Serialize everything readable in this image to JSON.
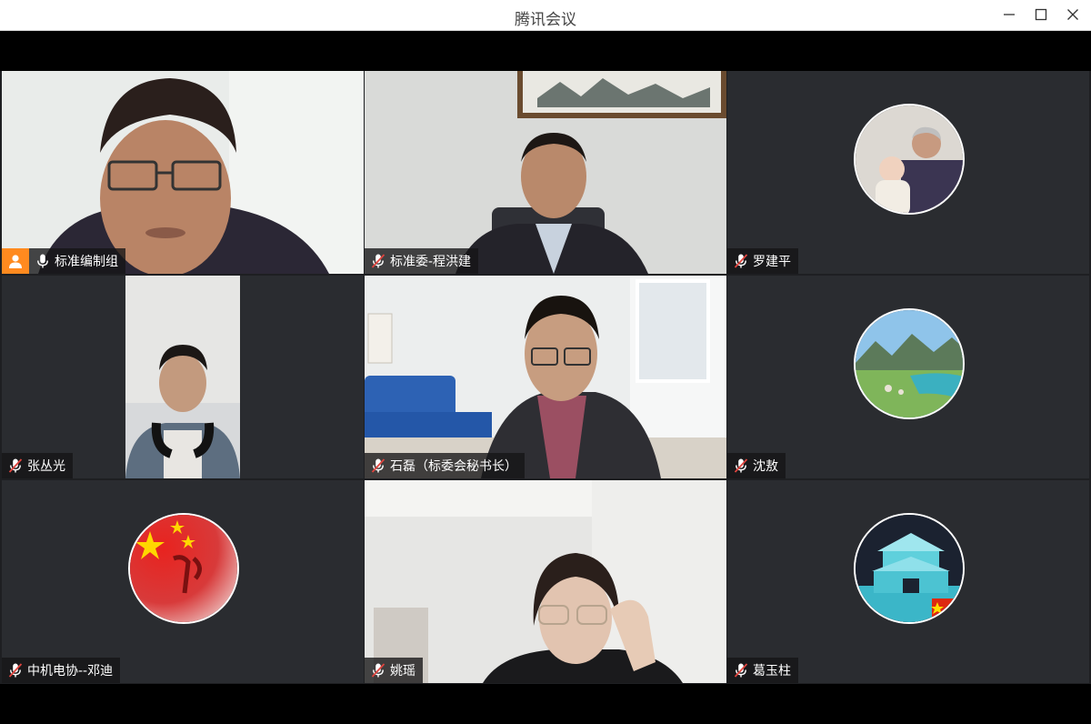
{
  "window": {
    "title": "腾讯会议"
  },
  "participants": [
    {
      "name": "标准编制组",
      "host": true,
      "mic": "on"
    },
    {
      "name": "标准委-程洪建",
      "host": false,
      "mic": "muted"
    },
    {
      "name": "罗建平",
      "host": false,
      "mic": "muted"
    },
    {
      "name": "张丛光",
      "host": false,
      "mic": "muted"
    },
    {
      "name": "石磊（标委会秘书长）",
      "host": false,
      "mic": "muted"
    },
    {
      "name": "沈敖",
      "host": false,
      "mic": "muted"
    },
    {
      "name": "中机电协--邓迪",
      "host": false,
      "mic": "muted"
    },
    {
      "name": "姚瑶",
      "host": false,
      "mic": "muted"
    },
    {
      "name": "葛玉柱",
      "host": false,
      "mic": "muted"
    }
  ],
  "colors": {
    "host_badge": "#ff8a1f",
    "tile_bg": "#2a2c30",
    "mute_slash": "#e0443e"
  },
  "icons": {
    "minimize": "minimize-icon",
    "maximize": "maximize-icon",
    "close": "close-icon",
    "mic": "microphone-icon",
    "mic_muted": "microphone-muted-icon",
    "host": "host-user-icon"
  }
}
